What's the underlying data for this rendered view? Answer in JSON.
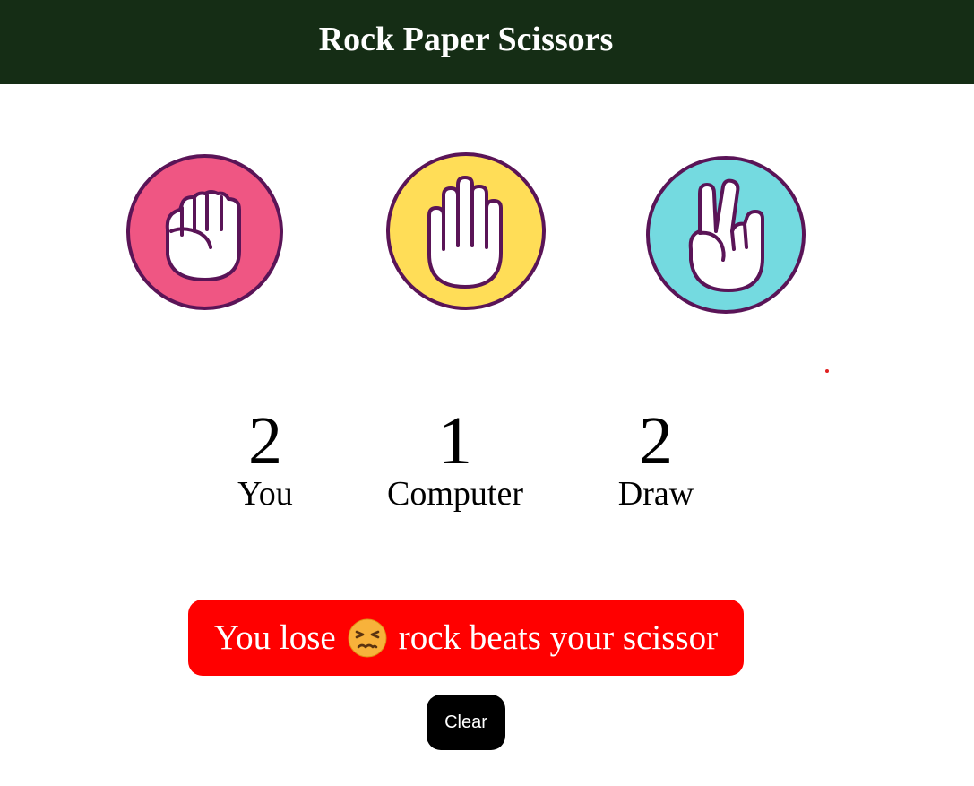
{
  "header": {
    "title": "Rock Paper Scissors",
    "background": "#152d15"
  },
  "choices": [
    {
      "id": "rock",
      "icon": "fist-icon",
      "color": "#ef5683"
    },
    {
      "id": "paper",
      "icon": "open-hand-icon",
      "color": "#ffdd57"
    },
    {
      "id": "scissors",
      "icon": "peace-hand-icon",
      "color": "#74dae0"
    }
  ],
  "outline_color": "#5a1457",
  "scores": {
    "you": {
      "value": "2",
      "label": "You"
    },
    "computer": {
      "value": "1",
      "label": "Computer"
    },
    "draw": {
      "value": "2",
      "label": "Draw"
    }
  },
  "result": {
    "prefix": "You lose",
    "emoji": "tired-face-emoji",
    "suffix": "rock beats your scissor",
    "background": "#ff0000"
  },
  "clear_button": {
    "label": "Clear"
  }
}
